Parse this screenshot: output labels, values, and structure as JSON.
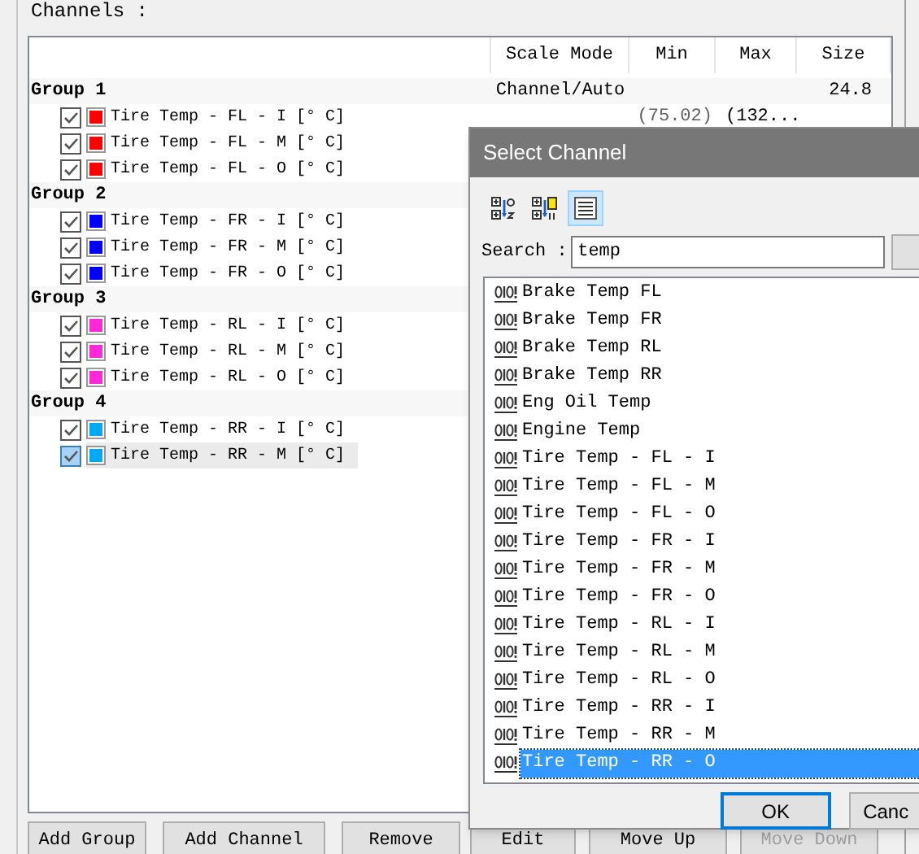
{
  "header": {
    "label": "Channels :"
  },
  "table": {
    "columns": [
      "Scale Mode",
      "Min",
      "Max",
      "Size"
    ],
    "groups": [
      {
        "name": "Group 1",
        "scale_mode": "Channel/Auto",
        "size": "24.8",
        "channels": [
          {
            "name": "Tire Temp - FL - I [° C]",
            "color": "#ff0000",
            "checked": true,
            "selected": false,
            "min": "(75.02)",
            "max": "(132..."
          },
          {
            "name": "Tire Temp - FL - M [° C]",
            "color": "#ff0000",
            "checked": true,
            "selected": false
          },
          {
            "name": "Tire Temp - FL - O [° C]",
            "color": "#ff0000",
            "checked": true,
            "selected": false
          }
        ]
      },
      {
        "name": "Group 2",
        "channels": [
          {
            "name": "Tire Temp - FR - I [° C]",
            "color": "#0000ff",
            "checked": true,
            "selected": false
          },
          {
            "name": "Tire Temp - FR - M [° C]",
            "color": "#0000ff",
            "checked": true,
            "selected": false
          },
          {
            "name": "Tire Temp - FR - O [° C]",
            "color": "#0000ff",
            "checked": true,
            "selected": false
          }
        ]
      },
      {
        "name": "Group 3",
        "channels": [
          {
            "name": "Tire Temp - RL - I [° C]",
            "color": "#ff28d8",
            "checked": true,
            "selected": false
          },
          {
            "name": "Tire Temp - RL - M [° C]",
            "color": "#ff28d8",
            "checked": true,
            "selected": false
          },
          {
            "name": "Tire Temp - RL - O [° C]",
            "color": "#ff28d8",
            "checked": true,
            "selected": false
          }
        ]
      },
      {
        "name": "Group 4",
        "channels": [
          {
            "name": "Tire Temp - RR - I [° C]",
            "color": "#00aaf0",
            "checked": true,
            "selected": false
          },
          {
            "name": "Tire Temp - RR - M [° C]",
            "color": "#00aaf0",
            "checked": true,
            "selected": true
          }
        ]
      }
    ]
  },
  "buttons": [
    {
      "label": "Add Group",
      "disabled": false
    },
    {
      "label": "Add Channel",
      "disabled": false
    },
    {
      "label": "Remove",
      "disabled": false
    },
    {
      "label": "Edit",
      "disabled": false
    },
    {
      "label": "Move Up",
      "disabled": false
    },
    {
      "label": "Move Down",
      "disabled": true
    }
  ],
  "dialog": {
    "title": "Select Channel",
    "view_buttons": [
      {
        "kind": "sort-alpha",
        "selected": false
      },
      {
        "kind": "sort-numeric",
        "selected": false
      },
      {
        "kind": "list",
        "selected": true
      }
    ],
    "search": {
      "label": "Search :",
      "value": "temp"
    },
    "channels": [
      {
        "name": "Brake Temp FL",
        "selected": false
      },
      {
        "name": "Brake Temp FR",
        "selected": false
      },
      {
        "name": "Brake Temp RL",
        "selected": false
      },
      {
        "name": "Brake Temp RR",
        "selected": false
      },
      {
        "name": "Eng Oil Temp",
        "selected": false
      },
      {
        "name": "Engine Temp",
        "selected": false
      },
      {
        "name": "Tire Temp - FL - I",
        "selected": false
      },
      {
        "name": "Tire Temp - FL - M",
        "selected": false
      },
      {
        "name": "Tire Temp - FL - O",
        "selected": false
      },
      {
        "name": "Tire Temp - FR - I",
        "selected": false
      },
      {
        "name": "Tire Temp - FR - M",
        "selected": false
      },
      {
        "name": "Tire Temp - FR - O",
        "selected": false
      },
      {
        "name": "Tire Temp - RL - I",
        "selected": false
      },
      {
        "name": "Tire Temp - RL - M",
        "selected": false
      },
      {
        "name": "Tire Temp - RL - O",
        "selected": false
      },
      {
        "name": "Tire Temp - RR - I",
        "selected": false
      },
      {
        "name": "Tire Temp - RR - M",
        "selected": false
      },
      {
        "name": "Tire Temp - RR - O",
        "selected": true
      }
    ],
    "buttons": [
      {
        "label": "OK",
        "default": true
      },
      {
        "label": "Canc",
        "default": false
      }
    ]
  }
}
